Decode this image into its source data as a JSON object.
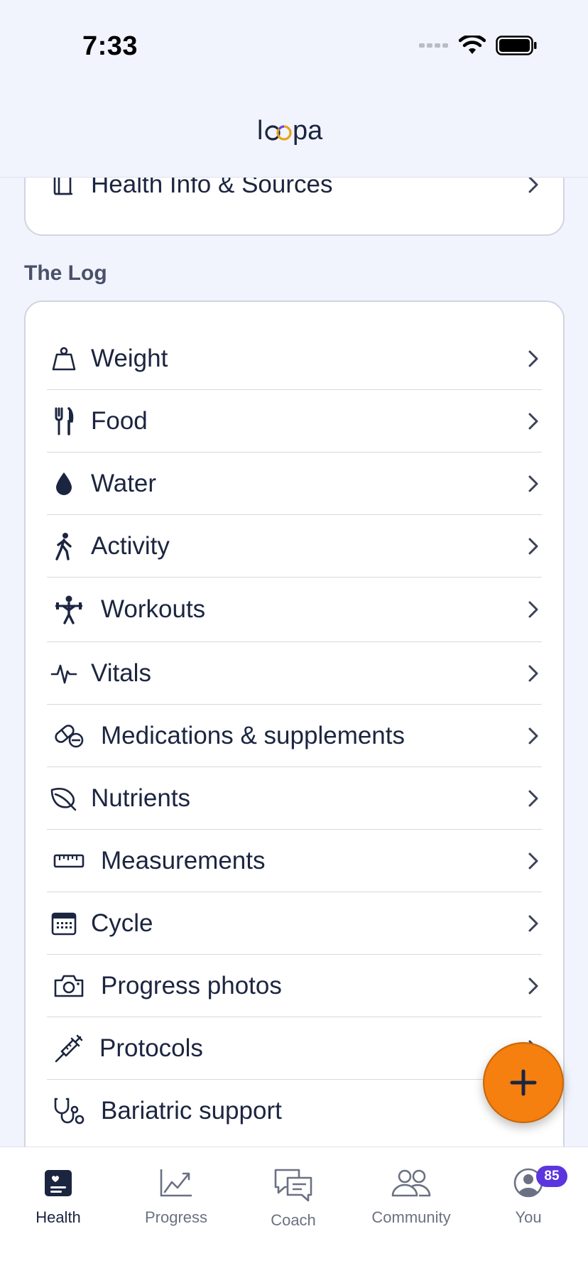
{
  "status_bar": {
    "time": "7:33"
  },
  "header": {
    "logo_text": "loopa"
  },
  "top_card": {
    "label": "Health Info & Sources"
  },
  "log_section": {
    "title": "The Log",
    "items": [
      {
        "label": "Weight",
        "icon": "weight-icon"
      },
      {
        "label": "Food",
        "icon": "fork-knife-icon"
      },
      {
        "label": "Water",
        "icon": "water-drop-icon"
      },
      {
        "label": "Activity",
        "icon": "walking-icon"
      },
      {
        "label": "Workouts",
        "icon": "weightlifter-icon"
      },
      {
        "label": "Vitals",
        "icon": "pulse-icon"
      },
      {
        "label": "Medications & supplements",
        "icon": "pill-icon"
      },
      {
        "label": "Nutrients",
        "icon": "leaf-icon"
      },
      {
        "label": "Measurements",
        "icon": "ruler-icon"
      },
      {
        "label": "Cycle",
        "icon": "calendar-icon"
      },
      {
        "label": "Progress photos",
        "icon": "camera-icon"
      },
      {
        "label": "Protocols",
        "icon": "syringe-icon"
      },
      {
        "label": "Bariatric support",
        "icon": "stethoscope-icon"
      }
    ]
  },
  "fab": {
    "icon": "plus-icon",
    "color": "#f57f0f"
  },
  "tabbar": {
    "tabs": [
      {
        "label": "Health",
        "icon": "health-icon",
        "active": true
      },
      {
        "label": "Progress",
        "icon": "chart-icon",
        "active": false
      },
      {
        "label": "Coach",
        "icon": "chat-icon",
        "active": false
      },
      {
        "label": "Community",
        "icon": "people-icon",
        "active": false
      },
      {
        "label": "You",
        "icon": "profile-icon",
        "active": false,
        "badge": "85"
      }
    ]
  },
  "colors": {
    "accent": "#f57f0f",
    "badge": "#5b35e0",
    "text": "#1c2540",
    "background": "#f1f4fc"
  }
}
